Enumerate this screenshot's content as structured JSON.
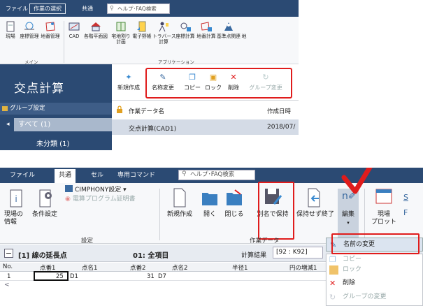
{
  "top": {
    "tabs": [
      "ファイル",
      "作業の選択",
      "共通"
    ],
    "search": "ヘルプ･FAQ検索",
    "ribbon_items": [
      "現場",
      "座標管理",
      "地番管理",
      "CAD",
      "各階平面図",
      "宅地割り\n計画",
      "電子野帳",
      "トラバース\n計算",
      "座標計算",
      "地番計算",
      "基準点関連",
      "地"
    ],
    "groups": [
      "メイン",
      "アプリケーション"
    ],
    "title": "交点計算",
    "group_setting": "グループ設定",
    "tree_all": "すべて (1)",
    "tree_uncategorized": "未分類 (1)",
    "toolbar": [
      "新規作成",
      "名称変更",
      "コピー",
      "ロック",
      "削除",
      "グループ変更"
    ],
    "columns": [
      "作業データ名",
      "作成日時"
    ],
    "row": {
      "name": "交点計算(CAD1)",
      "date": "2018/07/"
    }
  },
  "bottom": {
    "tabs": [
      "ファイル",
      "共通",
      "セル",
      "専用コマンド"
    ],
    "search": "ヘルプ･FAQ検索",
    "cimphony": "CIMPHONY設定",
    "program_cert": "電算プログラム証明書",
    "ribbon_items": {
      "site_info": "現場の\n情報",
      "cond": "条件設定",
      "new": "新規作成",
      "open": "開く",
      "close": "閉じる",
      "save_as": "別名で保持",
      "exit_nosave": "保持せず終了",
      "edit": "編集",
      "site_plot": "現場\nプロット"
    },
    "groups": [
      "設定",
      "作業データ"
    ],
    "record_tag": "[1] 線の延長点",
    "all_items": "01: 全項目",
    "calc_result_label": "計算結果",
    "calc_result_value": "[92 : K92]",
    "grid_headers": [
      "No.",
      "点番1",
      "点名1",
      "点番2",
      "点名2",
      "半径1",
      "円の増減1"
    ],
    "grid_row": [
      "1",
      "25",
      "D1",
      "31",
      "D7"
    ],
    "menu": [
      "名前の変更",
      "コピー",
      "ロック",
      "削除",
      "グループの変更"
    ],
    "minus": "−",
    "right_letters": [
      "S",
      "F"
    ]
  },
  "colors": {
    "navy": "#2b4a73",
    "red_highlight": "#e01c1c",
    "select_row": "#d4dbe6"
  }
}
